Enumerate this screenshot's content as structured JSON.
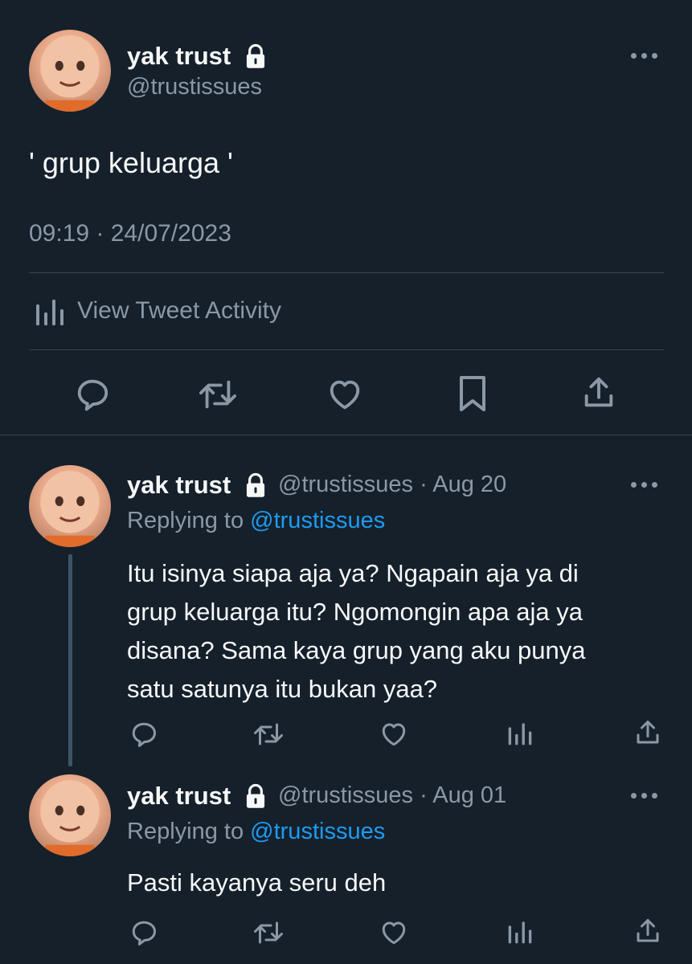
{
  "main_tweet": {
    "author_name": "yak trust",
    "handle": "@trustissues",
    "text": "' grup keluarga '",
    "timestamp": "09:19 · 24/07/2023",
    "activity_label": "View Tweet Activity"
  },
  "replies": [
    {
      "author_name": "yak trust",
      "handle": "@trustissues",
      "date": "· Aug 20",
      "replying_prefix": "Replying to",
      "replying_handle": "@trustissues",
      "text_lines": [
        "Itu isinya siapa aja ya? Ngapain aja ya di",
        "grup keluarga itu? Ngomongin apa aja ya",
        "disana? Sama kaya grup yang aku punya",
        "satu satunya itu bukan yaa?"
      ]
    },
    {
      "author_name": "yak trust",
      "handle": "@trustissues",
      "date": "· Aug 01",
      "replying_prefix": "Replying to",
      "replying_handle": "@trustissues",
      "text_lines": [
        "Pasti kayanya seru deh"
      ]
    }
  ],
  "icons": {
    "lock": "lock-icon",
    "more": "more-icon",
    "reply": "reply-icon",
    "retweet": "retweet-icon",
    "like": "like-icon",
    "bookmark": "bookmark-icon",
    "share": "share-icon",
    "analytics": "analytics-icon"
  },
  "colors": {
    "background": "#15202b",
    "text": "#f7f9f9",
    "muted": "#8b98a5",
    "link": "#1d9bf0",
    "divider": "#38444d"
  }
}
